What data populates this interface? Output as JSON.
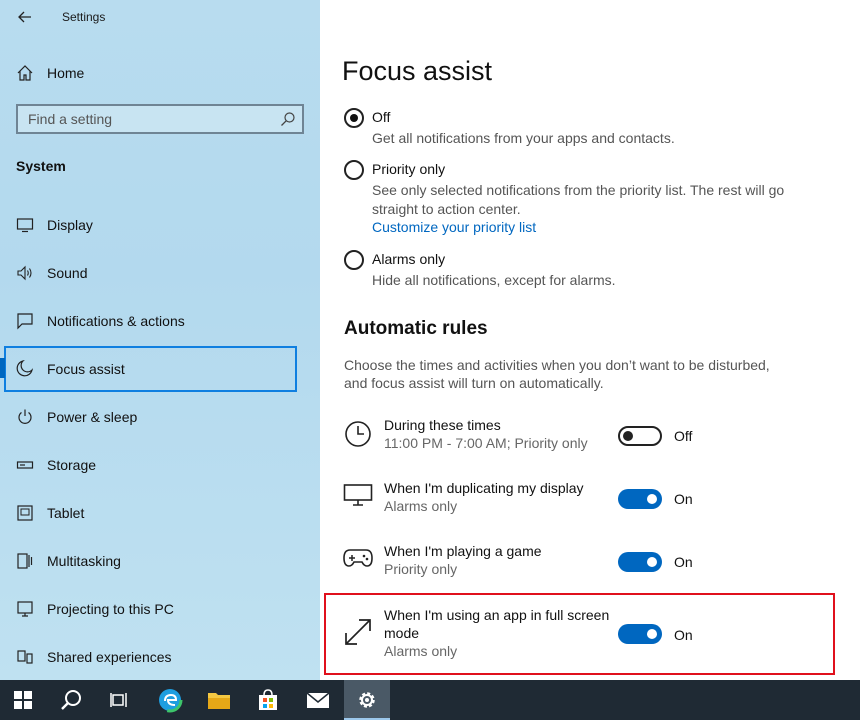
{
  "window": {
    "title": "Settings"
  },
  "sidebar": {
    "home_label": "Home",
    "search_placeholder": "Find a setting",
    "section_title": "System",
    "items": [
      {
        "label": "Display",
        "icon": "monitor-icon"
      },
      {
        "label": "Sound",
        "icon": "speaker-icon"
      },
      {
        "label": "Notifications & actions",
        "icon": "notification-icon"
      },
      {
        "label": "Focus assist",
        "icon": "moon-icon",
        "selected": true
      },
      {
        "label": "Power & sleep",
        "icon": "power-icon"
      },
      {
        "label": "Storage",
        "icon": "storage-icon"
      },
      {
        "label": "Tablet",
        "icon": "tablet-icon"
      },
      {
        "label": "Multitasking",
        "icon": "multitasking-icon"
      },
      {
        "label": "Projecting to this PC",
        "icon": "projecting-icon"
      },
      {
        "label": "Shared experiences",
        "icon": "shared-experiences-icon"
      }
    ]
  },
  "main": {
    "title": "Focus assist",
    "options": [
      {
        "label": "Off",
        "description": "Get all notifications from your apps and contacts.",
        "checked": true
      },
      {
        "label": "Priority only",
        "description": "See only selected notifications from the priority list. The rest will go straight to action center.",
        "link": "Customize your priority list",
        "checked": false
      },
      {
        "label": "Alarms only",
        "description": "Hide all notifications, except for alarms.",
        "checked": false
      }
    ],
    "rules_title": "Automatic rules",
    "rules_description": "Choose the times and activities when you don’t want to be disturbed, and focus assist will turn on automatically.",
    "rules": [
      {
        "title": "During these times",
        "subtitle": "11:00 PM - 7:00 AM; Priority only",
        "state": "Off",
        "on": false,
        "icon": "clock-icon"
      },
      {
        "title": "When I'm duplicating my display",
        "subtitle": "Alarms only",
        "state": "On",
        "on": true,
        "icon": "display-icon"
      },
      {
        "title": "When I'm playing a game",
        "subtitle": "Priority only",
        "state": "On",
        "on": true,
        "icon": "gamepad-icon"
      },
      {
        "title": "When I'm using an app in full screen mode",
        "subtitle": "Alarms only",
        "state": "On",
        "on": true,
        "icon": "fullscreen-icon"
      }
    ]
  },
  "taskbar": {
    "items": [
      "windows-start-icon",
      "search-icon",
      "task-view-icon",
      "edge-icon",
      "file-explorer-icon",
      "store-icon",
      "mail-icon",
      "settings-gear-icon"
    ],
    "active": "settings-gear-icon"
  },
  "colors": {
    "accent": "#0067c0",
    "highlight": "#e0101c",
    "sidebar_bg": "#b8dcef",
    "taskbar_bg": "#1f2a34"
  }
}
